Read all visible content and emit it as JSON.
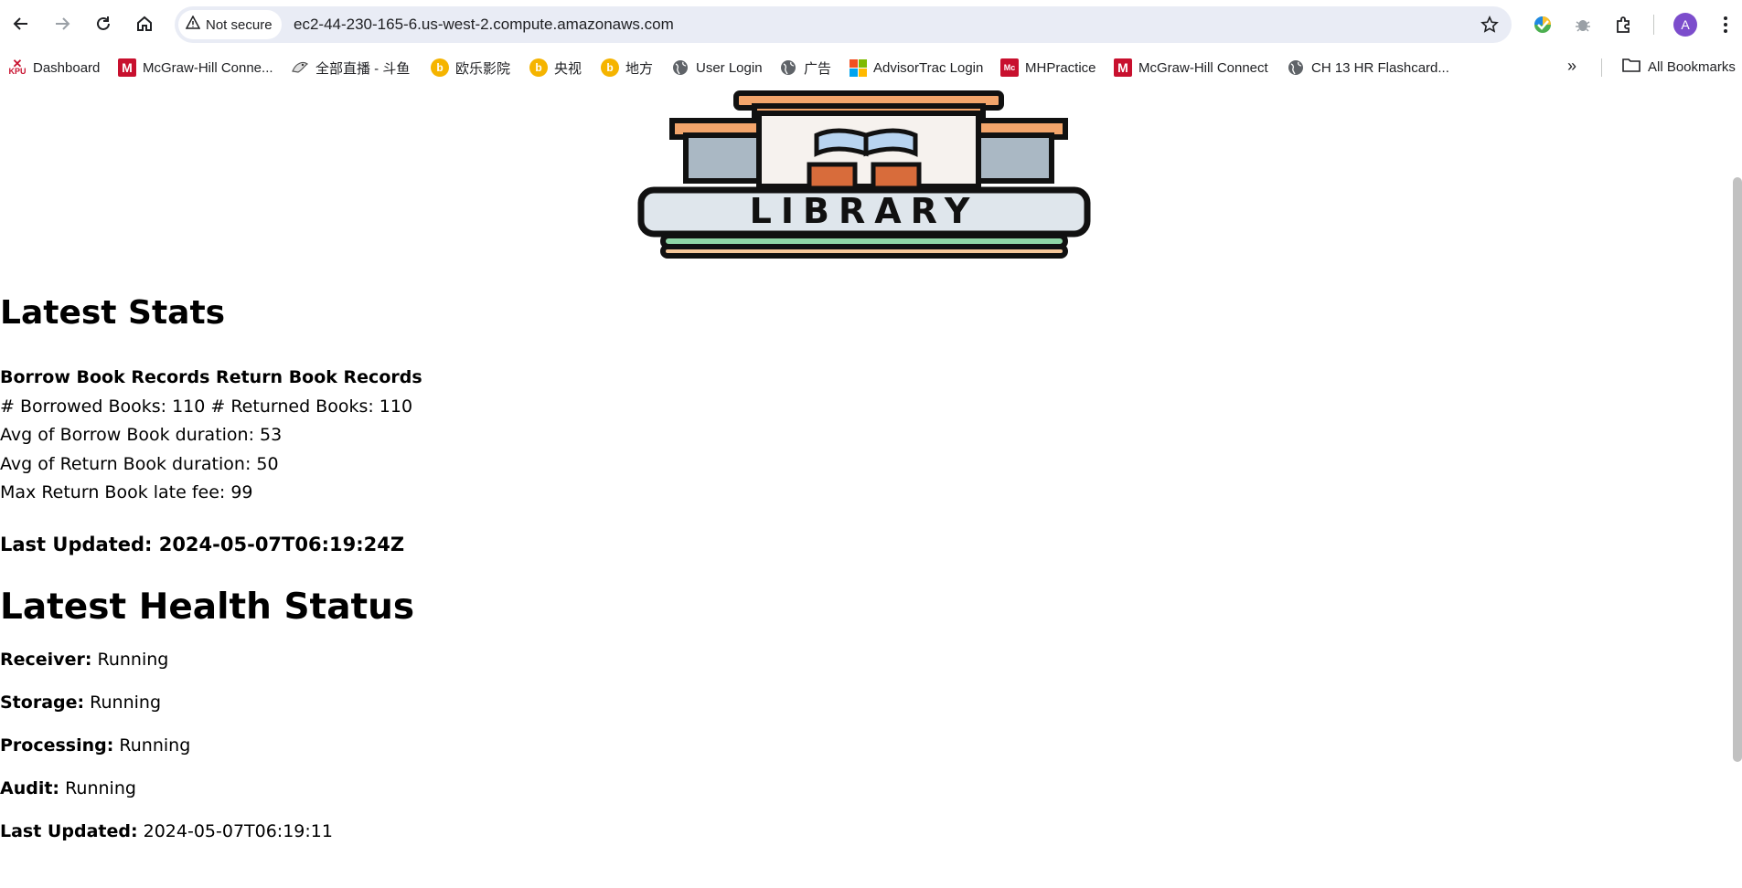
{
  "browser": {
    "security_label": "Not secure",
    "url": "ec2-44-230-165-6.us-west-2.compute.amazonaws.com",
    "profile_initial": "A",
    "icons": [
      "back-icon",
      "forward-icon",
      "reload-icon",
      "home-icon",
      "warning-icon",
      "star-icon",
      "extension-color-icon",
      "bug-icon",
      "puzzle-icon",
      "kebab-menu-icon"
    ]
  },
  "bookmarks": {
    "items": [
      {
        "label": "Dashboard",
        "icon_text": "KPU"
      },
      {
        "label": "McGraw-Hill Conne...",
        "icon_text": "M"
      },
      {
        "label": "全部直播 - 斗鱼",
        "icon_text": ""
      },
      {
        "label": "欧乐影院",
        "icon_text": "b"
      },
      {
        "label": "央视",
        "icon_text": "b"
      },
      {
        "label": "地方",
        "icon_text": "b"
      },
      {
        "label": "User Login",
        "icon_text": ""
      },
      {
        "label": "广告",
        "icon_text": ""
      },
      {
        "label": "AdvisorTrac Login",
        "icon_text": ""
      },
      {
        "label": "MHPractice",
        "icon_text": "Mc"
      },
      {
        "label": "McGraw-Hill Connect",
        "icon_text": "M"
      },
      {
        "label": "CH 13 HR Flashcard...",
        "icon_text": ""
      }
    ],
    "overflow": "»",
    "all_bookmarks": "All Bookmarks"
  },
  "logo": {
    "text": "LIBRARY"
  },
  "stats": {
    "title": "Latest Stats",
    "header": "Borrow Book Records Return Book Records",
    "counts_line": "# Borrowed Books: 110 # Returned Books: 110",
    "avg_borrow": "Avg of Borrow Book duration: 53",
    "avg_return": "Avg of Return Book duration: 50",
    "max_fee": "Max Return Book late fee: 99",
    "last_updated": "Last Updated: 2024-05-07T06:19:24Z"
  },
  "health": {
    "title": "Latest Health Status",
    "items": [
      {
        "label": "Receiver:",
        "value": "Running"
      },
      {
        "label": "Storage:",
        "value": "Running"
      },
      {
        "label": "Processing:",
        "value": "Running"
      },
      {
        "label": "Audit:",
        "value": "Running"
      }
    ],
    "last_updated_label": "Last Updated:",
    "last_updated_value": "2024-05-07T06:19:11"
  }
}
